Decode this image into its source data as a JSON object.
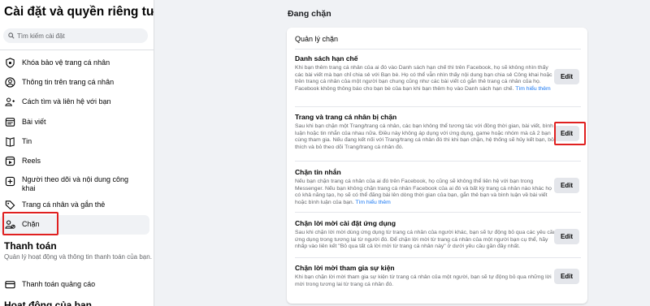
{
  "sidebar": {
    "title": "Cài đặt và quyền riêng tư",
    "search_placeholder": "Tìm kiếm cài đặt",
    "items": [
      {
        "label": "Khóa bảo vệ trang cá nhân"
      },
      {
        "label": "Thông tin trên trang cá nhân"
      },
      {
        "label": "Cách tìm và liên hệ với bạn"
      },
      {
        "label": "Bài viết"
      },
      {
        "label": "Tin"
      },
      {
        "label": "Reels"
      },
      {
        "label": "Người theo dõi và nội dung công khai"
      },
      {
        "label": "Trang cá nhân và gắn thẻ"
      },
      {
        "label": "Chặn"
      }
    ],
    "payments": {
      "title": "Thanh toán",
      "description": "Quản lý hoạt động và thông tin thanh toán của bạn.",
      "item_label": "Thanh toán quảng cáo"
    },
    "activity_title": "Hoạt động của bạn"
  },
  "main": {
    "title": "Đang chặn",
    "card_title": "Quản lý chặn",
    "edit_label": "Edit",
    "sections": [
      {
        "title": "Danh sách hạn chế",
        "description": "Khi bạn thêm trang cá nhân của ai đó vào Danh sách hạn chế thì trên Facebook, họ sẽ không nhìn thấy các bài viết mà bạn chỉ chia sẻ với Bạn bè. Họ có thể vẫn nhìn thấy nội dung bạn chia sẻ Công khai hoặc trên trang cá nhân của một người bạn chung cũng như các bài viết có gắn thẻ trang cá nhân của họ. Facebook không thông báo cho bạn bè của bạn khi bạn thêm họ vào Danh sách hạn chế.",
        "more": "Tìm hiểu thêm"
      },
      {
        "title": "Trang và trang cá nhân bị chặn",
        "description": "Sau khi bạn chặn một Trang/trang cá nhân, các bạn không thể tương tác với đồng thời gian, bài viết, bình luận hoặc tin nhắn của nhau nữa. Điều này không áp dụng với ứng dụng, game hoặc nhóm mà cả 2 bạn cùng tham gia. Nếu đang kết nối với Trang/trang cá nhân đó thì khi bạn chặn, hệ thống sẽ hủy kết bạn, bỏ thích và bỏ theo dõi Trang/trang cá nhân đó.",
        "more": ""
      },
      {
        "title": "Chặn tin nhắn",
        "description": "Nếu bạn chặn trang cá nhân của ai đó trên Facebook, họ cũng sẽ không thể liên hệ với bạn trong Messenger. Nếu bạn không chặn trang cá nhân Facebook của ai đó và bất kỳ trang cá nhân nào khác họ có khả năng tạo, họ sẽ có thể đăng bài lên dòng thời gian của bạn, gắn thẻ bạn và bình luận về bài viết hoặc bình luận của bạn.",
        "more": "Tìm hiểu thêm"
      },
      {
        "title": "Chặn lời mời cài đặt ứng dụng",
        "description": "Sau khi chặn lời mời dùng ứng dụng từ trang cá nhân của người khác, bạn sẽ tự động bỏ qua các yêu cầu ứng dụng trong tương lai từ người đó. Để chặn lời mời từ trang cá nhân của một người bạn cụ thể, hãy nhấp vào liên kết \"Bỏ qua tất cả lời mời từ trang cá nhân này\" ở dưới yêu cầu gần đây nhất.",
        "more": ""
      },
      {
        "title": "Chặn lời mời tham gia sự kiện",
        "description": "Khi bạn chặn lời mời tham gia sự kiện từ trang cá nhân của một người, bạn sẽ tự động bỏ qua những lời mời trong tương lai từ trang cá nhân đó.",
        "more": ""
      }
    ]
  },
  "colors": {
    "highlight": "#e02020",
    "link": "#1877f2",
    "button_bg": "#e4e6eb"
  }
}
